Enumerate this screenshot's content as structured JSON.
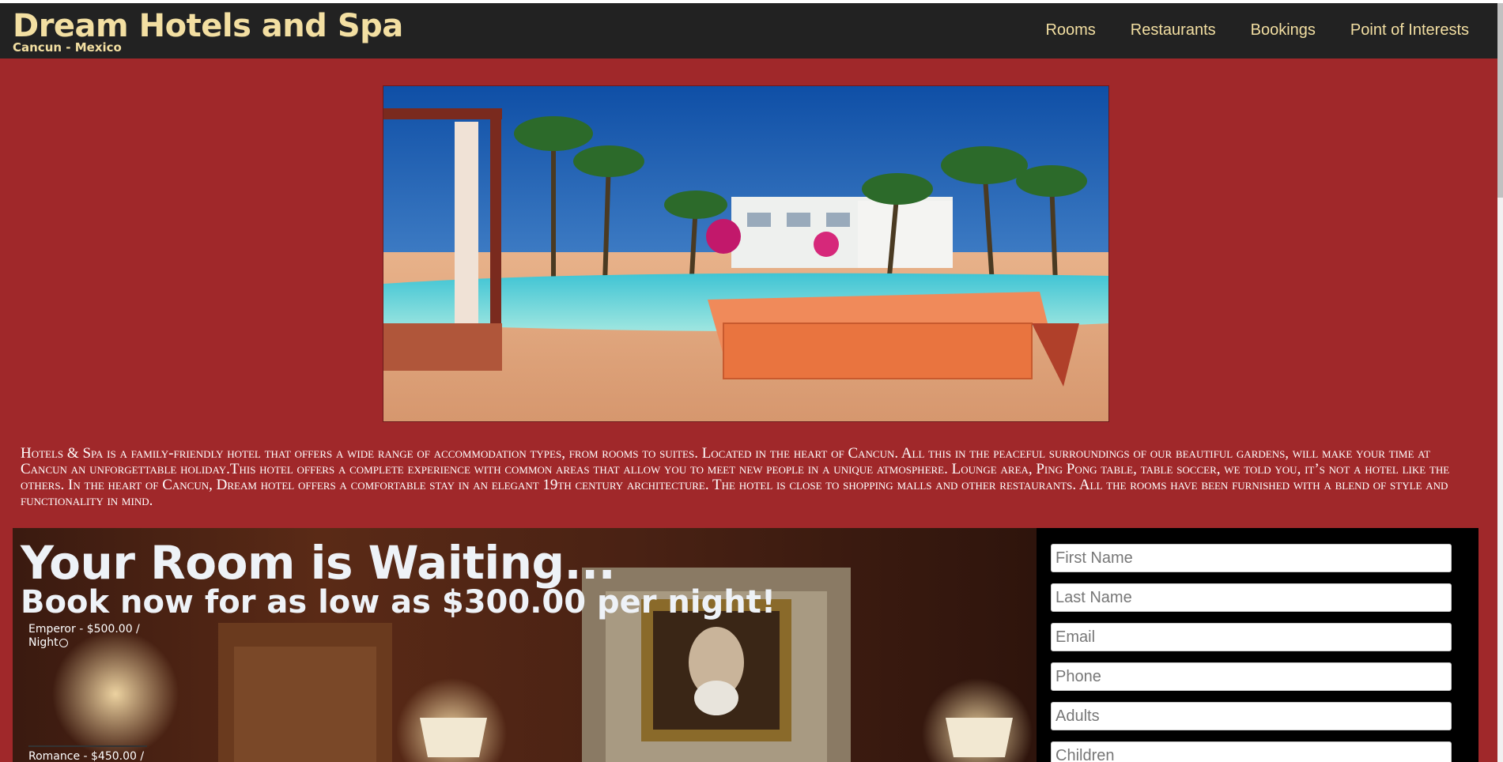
{
  "brand": {
    "title": "Dream Hotels and Spa",
    "subtitle": "Cancun - Mexico"
  },
  "nav": {
    "items": [
      "Rooms",
      "Restaurants",
      "Bookings",
      "Point of Interests"
    ]
  },
  "description": "Hotels & Spa is a family-friendly hotel that offers a wide range of accommodation types, from rooms to suites. Located in the heart of Cancun. All this in the peaceful surroundings of our beautiful gardens, will make your time at Cancun an unforgettable holiday.This hotel offers a complete experience with common areas that allow you to meet new people in a unique atmosphere. Lounge area, Ping Pong table, table soccer, we told you, it’s not a hotel like the others. In the heart of Cancun, Dream hotel offers a comfortable stay in an elegant 19th century architecture. The hotel is close to shopping malls and other restaurants. All the rooms have been furnished with a blend of style and functionality in mind.",
  "booking": {
    "title": "Your Room is Waiting...",
    "subtitle": "Book now for as low as $300.00 per night!",
    "rooms": [
      {
        "label": "Emperor - $500.00 / Night"
      },
      {
        "label": "Romance - $450.00 /"
      }
    ],
    "form": {
      "first_name": "First Name",
      "last_name": "Last Name",
      "email": "Email",
      "phone": "Phone",
      "adults": "Adults",
      "children": "Children"
    }
  },
  "colors": {
    "page_bg": "#a0282a",
    "navbar_bg": "#222222",
    "accent_text": "#f3dfa2"
  }
}
